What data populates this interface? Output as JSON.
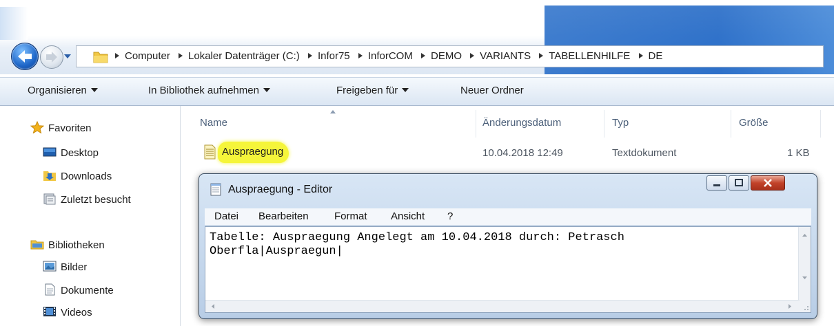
{
  "address_bar": {
    "crumbs": [
      "Computer",
      "Lokaler Datenträger (C:)",
      "Infor75",
      "InforCOM",
      "DEMO",
      "VARIANTS",
      "TABELLENHILFE",
      "DE"
    ]
  },
  "toolbar": {
    "organize_label": "Organisieren",
    "library_label": "In Bibliothek aufnehmen",
    "share_label": "Freigeben für",
    "new_folder_label": "Neuer Ordner"
  },
  "nav": {
    "favorites_label": "Favoriten",
    "desktop_label": "Desktop",
    "downloads_label": "Downloads",
    "recent_label": "Zuletzt besucht",
    "libraries_label": "Bibliotheken",
    "pictures_label": "Bilder",
    "documents_label": "Dokumente",
    "videos_label": "Videos"
  },
  "columns": {
    "name": "Name",
    "modified": "Änderungsdatum",
    "type": "Typ",
    "size": "Größe"
  },
  "file": {
    "name": "Auspraegung",
    "modified": "10.04.2018 12:49",
    "type": "Textdokument",
    "size": "1 KB"
  },
  "editor": {
    "title": "Auspraegung - Editor",
    "menus": [
      "Datei",
      "Bearbeiten",
      "Format",
      "Ansicht",
      "?"
    ],
    "lines": [
      "Tabelle: Auspraegung Angelegt am 10.04.2018 durch: Petrasch",
      "Oberfla|Auspraegun|"
    ]
  },
  "colors": {
    "highlight": "#f5f53a",
    "close_button": "#c2432a",
    "toolbar_top": "#f5f9fd",
    "toolbar_bottom": "#dbe6f3"
  }
}
